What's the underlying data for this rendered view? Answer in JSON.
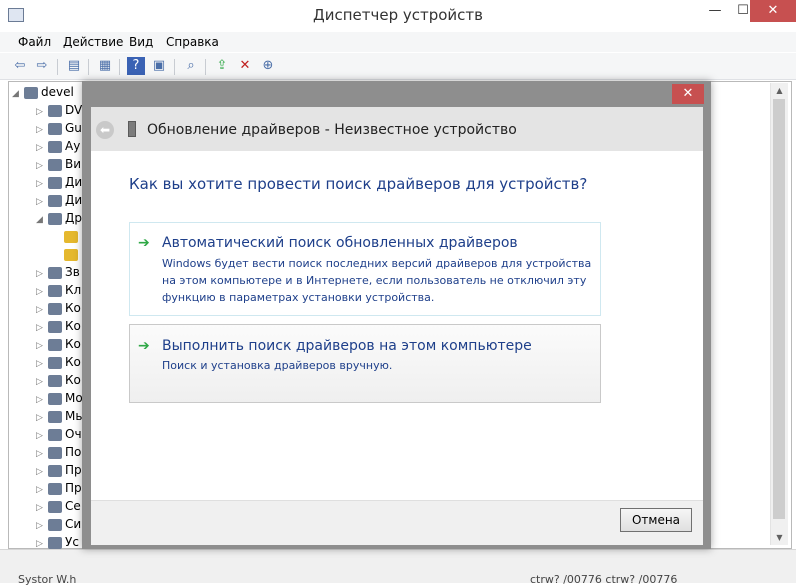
{
  "window": {
    "title": "Диспетчер устройств",
    "minimize_glyph": "—",
    "maximize_glyph": "☐",
    "close_glyph": "✕"
  },
  "menubar": {
    "items": [
      "Файл",
      "Действие",
      "Вид",
      "Справка"
    ]
  },
  "toolbar": {
    "icons": [
      "back-icon",
      "forward-icon",
      "properties-icon",
      "details-icon",
      "help-icon",
      "view-icon",
      "scan-icon",
      "update-driver-icon",
      "uninstall-icon",
      "add-device-icon"
    ],
    "glyphs": [
      "⇦",
      "⇨",
      "▤",
      "▦",
      "?",
      "▣",
      "⌕",
      "⇪",
      "✕",
      "⊕"
    ]
  },
  "tree": {
    "root_label": "devel",
    "rows": [
      {
        "text": "DV",
        "arrow": "▷"
      },
      {
        "text": "Gu",
        "arrow": "▷"
      },
      {
        "text": "Ау",
        "arrow": "▷"
      },
      {
        "text": "Ви",
        "arrow": "▷"
      },
      {
        "text": "Ди",
        "arrow": "▷"
      },
      {
        "text": "Ди",
        "arrow": "▷"
      },
      {
        "text": "Др",
        "arrow": "◢"
      },
      {
        "text": "",
        "arrow": ""
      },
      {
        "text": "",
        "arrow": ""
      },
      {
        "text": "Зв",
        "arrow": "▷"
      },
      {
        "text": "Кл",
        "arrow": "▷"
      },
      {
        "text": "Ко",
        "arrow": "▷"
      },
      {
        "text": "Ко",
        "arrow": "▷"
      },
      {
        "text": "Ко",
        "arrow": "▷"
      },
      {
        "text": "Ко",
        "arrow": "▷"
      },
      {
        "text": "Ко",
        "arrow": "▷"
      },
      {
        "text": "Мо",
        "arrow": "▷"
      },
      {
        "text": "Мь",
        "arrow": "▷"
      },
      {
        "text": "Оч",
        "arrow": "▷"
      },
      {
        "text": "По",
        "arrow": "▷"
      },
      {
        "text": "Пр",
        "arrow": "▷"
      },
      {
        "text": "Пр",
        "arrow": "▷"
      },
      {
        "text": "Се",
        "arrow": "▷"
      },
      {
        "text": "Си",
        "arrow": "▷"
      },
      {
        "text": "Ус",
        "arrow": "▷"
      }
    ]
  },
  "statusbar": {
    "left": "Systor W.h",
    "right": "ctrw? /00776  ctrw? /00776"
  },
  "dialog": {
    "close_glyph": "✕",
    "back_glyph": "⬅",
    "title": "Обновление драйверов - Неизвестное устройство",
    "question": "Как вы хотите провести поиск драйверов для устройств?",
    "option_auto": {
      "arrow": "➔",
      "title": "Автоматический поиск обновленных драйверов",
      "description": "Windows будет вести поиск последних версий драйверов для устройства на этом компьютере и в Интернете, если пользователь не отключил эту функцию в параметрах установки устройства."
    },
    "option_manual": {
      "arrow": "➔",
      "title": "Выполнить поиск драйверов на этом компьютере",
      "description": "Поиск и установка драйверов вручную."
    },
    "cancel_label": "Отмена"
  },
  "colors": {
    "accent_link": "#1e3f8a",
    "arrow_green": "#2fa846",
    "close_red": "#c75050"
  }
}
